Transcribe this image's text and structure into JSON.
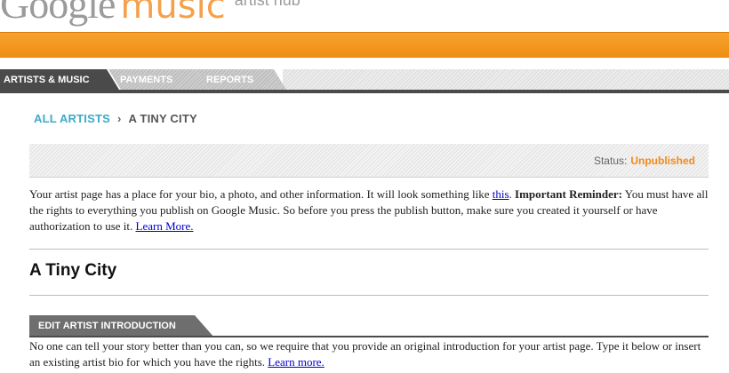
{
  "header": {
    "logo_google": "Google",
    "logo_music": "music",
    "logo_hub": "artist hub"
  },
  "nav": {
    "tabs": [
      {
        "label": "ARTISTS & MUSIC",
        "active": true
      },
      {
        "label": "PAYMENTS",
        "active": false
      },
      {
        "label": "REPORTS",
        "active": false
      }
    ]
  },
  "breadcrumb": {
    "all_artists": "ALL ARTISTS",
    "separator": "›",
    "current": "A TINY CITY"
  },
  "status": {
    "label": "Status:",
    "value": "Unpublished"
  },
  "intro": {
    "text_1": "Your artist page has a place for your bio, a photo, and other information. It will look something like ",
    "link_this": "this",
    "text_2": ". ",
    "important": "Important Reminder:",
    "text_3": " You must have all the rights to everything you publish on Google Music. So before you press the publish button, make sure you created it yourself or have authorization to use it. ",
    "link_learn": "Learn More."
  },
  "artist": {
    "name": "A Tiny City"
  },
  "section": {
    "title": "EDIT ARTIST INTRODUCTION",
    "text": "No one can tell your story better than you can, so we require that you provide an original introduction for your artist page. Type it below or insert an existing artist bio for which you have the rights. ",
    "link_learn": "Learn more."
  },
  "colors": {
    "orange": "#f09020",
    "dark_tab": "#4a4a4a",
    "link_blue": "#3eaac8",
    "status_orange": "#f28a1c"
  }
}
